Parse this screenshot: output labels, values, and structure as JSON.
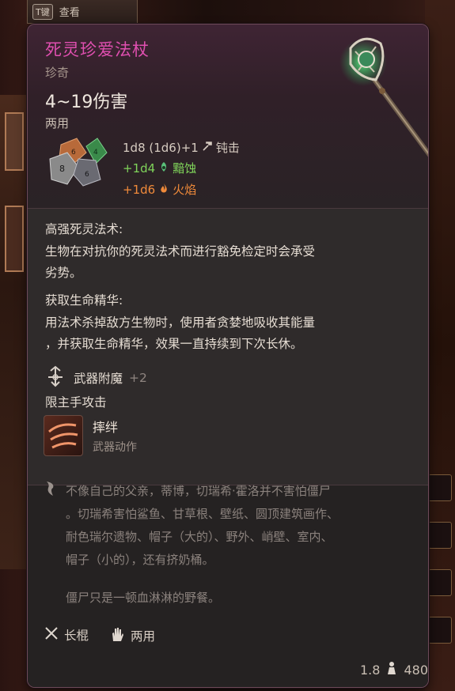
{
  "hint": {
    "key": "T键",
    "label": "查看"
  },
  "item": {
    "name": "死灵珍爱法杖",
    "rarity": "珍奇",
    "damage": "4~19伤害",
    "grip": "两用",
    "damage_lines": [
      {
        "dice": "1d8 (1d6)+1",
        "type": "钝击",
        "icon": "hammer-icon",
        "color": "#d6cbc0"
      },
      {
        "dice": "+1d4",
        "type": "黯蚀",
        "icon": "necrotic-icon",
        "color": "#7fd35a"
      },
      {
        "dice": "+1d6",
        "type": "火焰",
        "icon": "fire-icon",
        "color": "#f08a3a"
      }
    ]
  },
  "passives": [
    {
      "title": "高强死灵法术:",
      "lines": [
        "生物在对抗你的死灵法术而进行豁免检定时会承受",
        "劣势。"
      ]
    },
    {
      "title": "获取生命精华:",
      "lines": [
        "用法术杀掉敌方生物时，使用者贪婪地吸收其能量",
        "，并获取生命精华，效果一直持续到下次长休。"
      ]
    }
  ],
  "enchant": {
    "label": "武器附魔",
    "value": "+2"
  },
  "main_hand": "限主手攻击",
  "action": {
    "name": "摔绊",
    "type": "武器动作"
  },
  "lore": {
    "lines": [
      "不像自己的父亲，蒂博，切瑞希·霍洛并不害怕僵尸",
      "。切瑞希害怕鲨鱼、甘草根、壁纸、圆顶建筑画作、",
      "耐色瑞尔遗物、帽子（大的）、野外、峭壁、室内、",
      "帽子（小的），还有挤奶桶。",
      "",
      "僵尸只是一顿血淋淋的野餐。"
    ]
  },
  "properties": [
    {
      "label": "长棍",
      "icon": "quarterstaff-icon"
    },
    {
      "label": "两用",
      "icon": "versatile-hand-icon"
    }
  ],
  "footer": {
    "weight": "1.8",
    "price": "480"
  }
}
